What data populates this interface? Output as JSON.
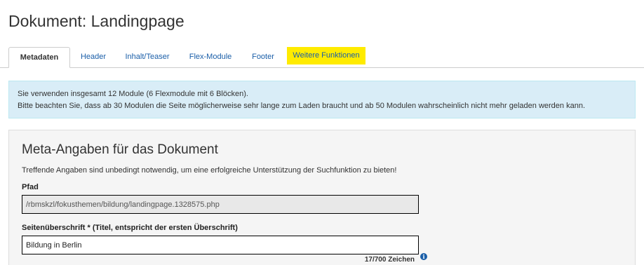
{
  "page": {
    "title": "Dokument: Landingpage"
  },
  "tabs": [
    {
      "label": "Metadaten",
      "active": true
    },
    {
      "label": "Header"
    },
    {
      "label": "Inhalt/Teaser"
    },
    {
      "label": "Flex-Module"
    },
    {
      "label": "Footer"
    },
    {
      "label": "Weitere Funktionen",
      "highlight_color": "#ffeb00"
    }
  ],
  "info_box": {
    "line1": "Sie verwenden insgesamt 12 Module (6 Flexmodule mit 6 Blöcken).",
    "line2": "Bitte beachten Sie, dass ab 30 Modulen die Seite möglicherweise sehr lange zum Laden braucht und ab 50 Modulen wahrscheinlich nicht mehr geladen werden kann."
  },
  "meta_section": {
    "title": "Meta-Angaben für das Dokument",
    "description": "Treffende Angaben sind unbedingt notwendig, um eine erfolgreiche Unterstützung der Suchfunktion zu bieten!",
    "path": {
      "label": "Pfad",
      "value": "/rbmskzl/fokusthemen/bildung/landingpage.1328575.php"
    },
    "heading": {
      "label": "Seitenüberschrift * (Titel, entspricht der ersten Überschrift)",
      "value": "Bildung in Berlin",
      "char_count": "17/700 Zeichen",
      "info_icon_glyph": "i"
    }
  },
  "colors": {
    "link": "#1a5ea8",
    "info_background": "#d9edf7",
    "highlight": "#ffeb00"
  },
  "icons": {
    "info": "info-icon"
  }
}
